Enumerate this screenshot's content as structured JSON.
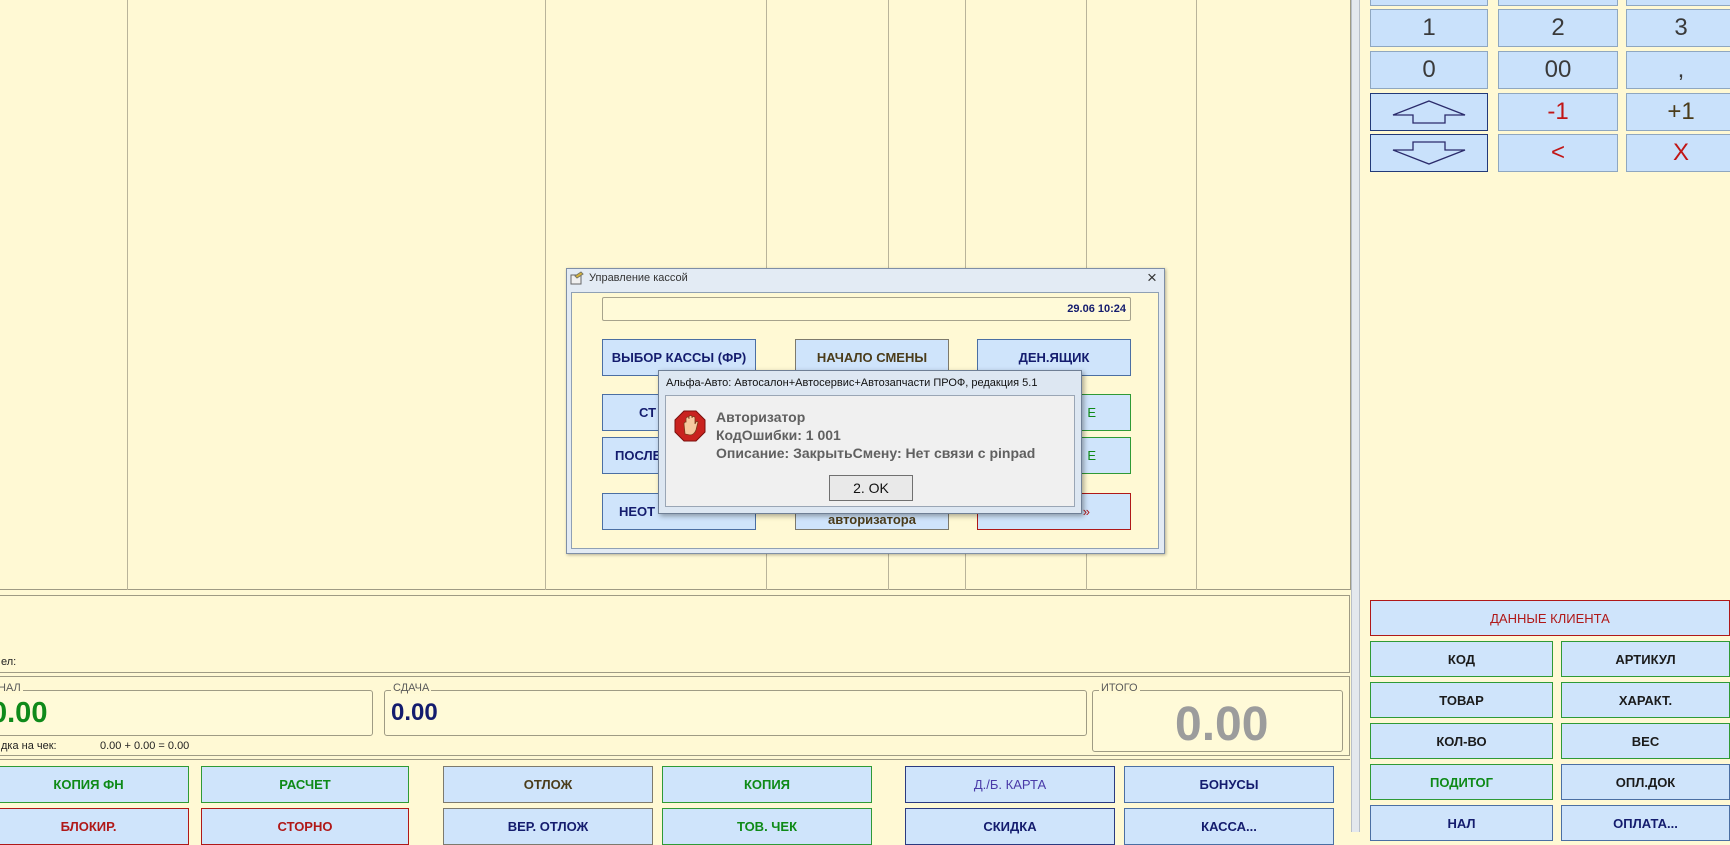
{
  "grid": {},
  "keypad": {
    "keys": [
      "1",
      "2",
      "3",
      "0",
      "00",
      ",",
      "-1",
      "+1",
      "<",
      "X"
    ]
  },
  "client_panel": {
    "client_data": "ДАННЫЕ КЛИЕНТА",
    "buttons": [
      "КОД",
      "АРТИКУЛ",
      "ТОВАР",
      "ХАРАКТ.",
      "КОЛ-ВО",
      "ВЕС",
      "ПОДИТОГ",
      "ОПЛ.ДОК",
      "НАЛ",
      "ОПЛАТА..."
    ]
  },
  "info": {
    "seller_label": "ел:",
    "cash_legend": "НАЛ",
    "cash_value": "0.00",
    "change_legend": "СДАЧА",
    "change_value": "0.00",
    "total_legend": "ИТОГО",
    "total_value": "0.00",
    "discount_label": "дка на чек:",
    "discount_value": "0.00 + 0.00 = 0.00"
  },
  "bottom_buttons": [
    "КОПИЯ ФН",
    "РАСЧЕТ",
    "ОТЛОЖ",
    "КОПИЯ",
    "Д./Б. КАРТА",
    "БОНУСЫ",
    "БЛОКИР.",
    "СТОРНО",
    "ВЕР. ОТЛОЖ",
    "ТОВ. ЧЕК",
    "СКИДКА",
    "КАССА..."
  ],
  "cash_dialog": {
    "title": "Управление кассой",
    "close": "×",
    "datetime": "29.06 10:24",
    "buttons": {
      "select_register": "ВЫБОР КАССЫ (ФР)",
      "start_shift": "НАЧАЛО СМЕНЫ",
      "cash_drawer": "ДЕН.ЯЩИК",
      "row2_left": "СТ",
      "row2_right": "Е",
      "row3_left": "ПОСЛЕ",
      "row3_right": "Е",
      "row4_left": "НЕОТ",
      "row4_mid": "авторизатора",
      "row4_right": "»"
    }
  },
  "error_dialog": {
    "title": "Альфа-Авто: Автосалон+Автосервис+Автозапчасти ПРОФ, редакция 5.1",
    "heading": "Авторизатор",
    "code_line": "КодОшибки: 1 001",
    "desc_line": "Описание: ЗакрытьСмену: Нет связи с pinpad",
    "ok": "2. OK"
  }
}
